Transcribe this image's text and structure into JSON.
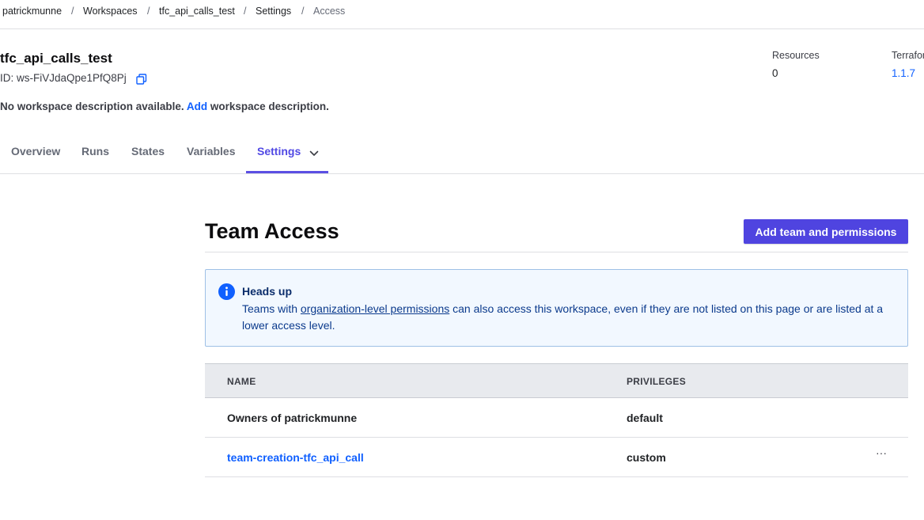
{
  "breadcrumb": {
    "items": [
      "patrickmunne",
      "Workspaces",
      "tfc_api_calls_test",
      "Settings",
      "Access"
    ],
    "separator": "/"
  },
  "workspace": {
    "name": "tfc_api_calls_test",
    "id_text": "ID: ws-FiVJdaQpe1PfQ8Pj",
    "description_prefix": "No workspace description available.",
    "description_link": "Add",
    "description_suffix": "workspace description."
  },
  "stats": {
    "resources_label": "Resources",
    "resources_value": "0",
    "terraform_label": "Terrafor",
    "terraform_value": "1.1.7"
  },
  "tabs": [
    "Overview",
    "Runs",
    "States",
    "Variables",
    "Settings"
  ],
  "active_tab": "Settings",
  "page": {
    "title": "Team Access",
    "add_button": "Add team and permissions"
  },
  "alert": {
    "title": "Heads up",
    "body_prefix": "Teams with",
    "body_link": "organization-level permissions",
    "body_suffix": "can also access this workspace, even if they are not listed on this page or are listed at a lower access level."
  },
  "table": {
    "headers": [
      "NAME",
      "PRIVILEGES"
    ],
    "rows": [
      {
        "name": "Owners of patrickmunne",
        "privileges": "default",
        "menu": ""
      },
      {
        "name": "team-creation-tfc_api_call",
        "privileges": "custom",
        "menu": "···"
      }
    ]
  },
  "colors": {
    "accent": "#5b4fe3",
    "link": "#1060ff",
    "alert_bg": "#f2f8ff"
  },
  "icons": [
    "copy-icon",
    "chevron-down-icon",
    "info-icon",
    "more-actions-icon"
  ]
}
